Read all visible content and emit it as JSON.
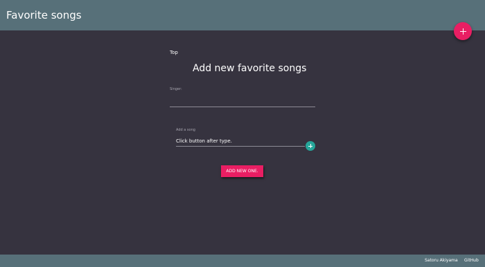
{
  "header": {
    "title": "Favorite songs",
    "fab_icon": "plus-icon"
  },
  "main": {
    "top_link": "Top",
    "heading": "Add new favorite songs",
    "singer": {
      "label": "Singer:",
      "value": ""
    },
    "song": {
      "label": "Add a song",
      "placeholder": "Click button after type.",
      "add_icon": "plus-icon"
    },
    "add_new_button": "ADD NEW ONE."
  },
  "footer": {
    "author": "Satoru Akiyama",
    "github": "GitHub"
  },
  "colors": {
    "header_bg": "#577079",
    "page_bg": "#36333f",
    "accent_pink": "#e91e63",
    "accent_teal": "#26a69a"
  }
}
